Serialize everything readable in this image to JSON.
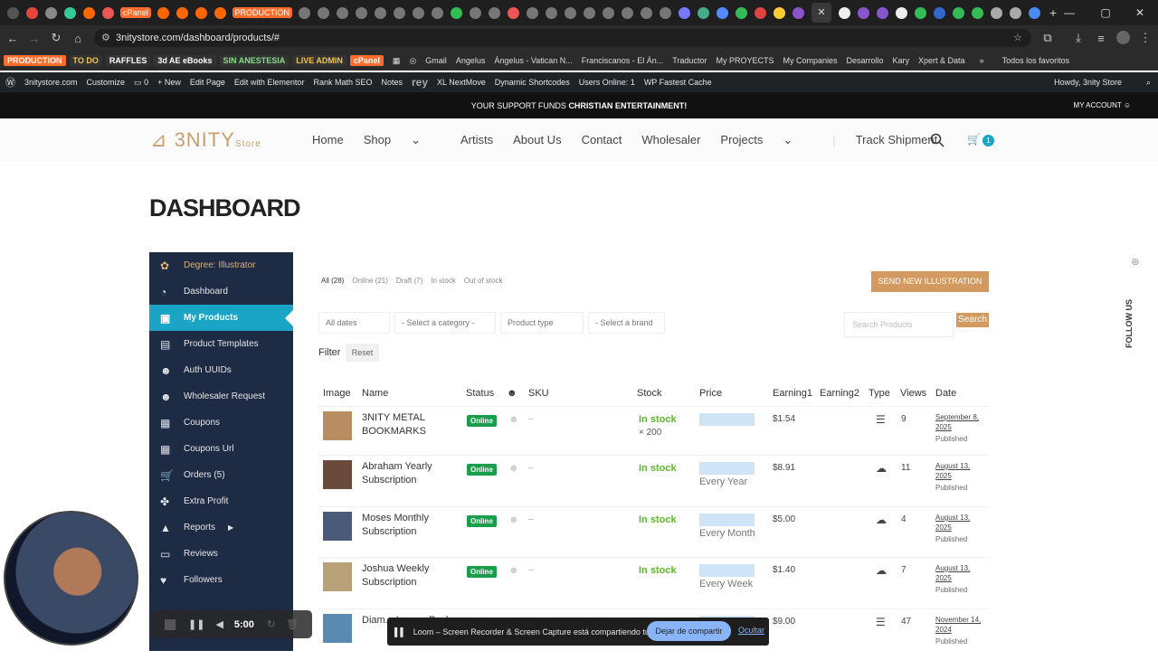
{
  "browser": {
    "tab_pills": [
      "cPanel",
      "PRODUCTION"
    ],
    "url": "3nitystore.com/dashboard/products/#",
    "bookmarks_tags": [
      "PRODUCTION",
      "TO DO",
      "RAFFLES",
      "3d AE eBooks",
      "SIN ANESTESIA",
      "LIVE ADMIN",
      "cPanel"
    ],
    "bookmarks": [
      "Gmail",
      "Angelus",
      "Ángelus - Vatican N...",
      "Franciscanos - El Án...",
      "Traductor",
      "My PROYECTS",
      "My Companies",
      "Desarrollo",
      "Kary",
      "Xpert & Data"
    ],
    "all_bookmarks": "Todos los favoritos"
  },
  "wp_admin_bar": {
    "site": "3nitystore.com",
    "customize": "Customize",
    "comments": "0",
    "new": "New",
    "edit_page": "Edit Page",
    "elementor": "Edit with Elementor",
    "rankmath": "Rank Math SEO",
    "notes": "Notes",
    "rey": "rey",
    "xlnext": "XL NextMove",
    "shortcodes": "Dynamic Shortcodes",
    "users_online": "Users Online: 1",
    "cache": "WP Fastest Cache",
    "howdy": "Howdy, 3nity Store"
  },
  "topnote": {
    "text": "YOUR SUPPORT FUNDS",
    "bold": "CHRISTIAN ENTERTAINMENT!",
    "account": "MY ACCOUNT"
  },
  "header": {
    "logo": "3NITY",
    "logo_sub": "Store",
    "menu": [
      "Home",
      "Shop",
      "Artists",
      "About Us",
      "Contact",
      "Wholesaler",
      "Projects",
      "Track Shipment"
    ],
    "cart_count": "1"
  },
  "page_title": "DASHBOARD",
  "sidebar": {
    "items": [
      {
        "icon": "✿",
        "label": "Degree: Illustrator"
      },
      {
        "icon": "◔",
        "label": "Dashboard"
      },
      {
        "icon": "▣",
        "label": "My Products"
      },
      {
        "icon": "▤",
        "label": "Product Templates"
      },
      {
        "icon": "☻",
        "label": "Auth UUIDs"
      },
      {
        "icon": "☻",
        "label": "Wholesaler Request"
      },
      {
        "icon": "▦",
        "label": "Coupons"
      },
      {
        "icon": "▦",
        "label": "Coupons Url"
      },
      {
        "icon": "🛒",
        "label": "Orders (5)"
      },
      {
        "icon": "✤",
        "label": "Extra Profit"
      },
      {
        "icon": "▲",
        "label": "Reports"
      },
      {
        "icon": "▭",
        "label": "Reviews"
      },
      {
        "icon": "♥",
        "label": "Followers"
      }
    ]
  },
  "filters": [
    "All (28)",
    "Online (21)",
    "Draft (7)",
    "In stock",
    "Out of stock"
  ],
  "send_button": "SEND NEW ILLUSTRATION",
  "selects": {
    "dates": "All dates",
    "category": "- Select a category -",
    "type": "Product type",
    "brand": "- Select a brand"
  },
  "search": {
    "placeholder": "Search Products",
    "button": "Search"
  },
  "filter_label": "Filter",
  "reset": "Reset",
  "table": {
    "headers": [
      "Image",
      "Name",
      "Status",
      "SKU",
      "Stock",
      "Price",
      "Earning1",
      "Earning2",
      "Type",
      "Views",
      "Date"
    ],
    "rows": [
      {
        "name": "3NITY METAL BOOKMARKS",
        "status": "Online",
        "sku": "–",
        "stock": "In stock",
        "qty": "× 200",
        "period": "",
        "earn": "$1.54",
        "type": "☰",
        "views": "9",
        "date": "September 8, 2025",
        "pub": "Published",
        "thumb": "#b98d62"
      },
      {
        "name": "Abraham Yearly Subscription",
        "status": "Online",
        "sku": "–",
        "stock": "In stock",
        "qty": "",
        "period": "Every Year",
        "earn": "$8.91",
        "type": "☁",
        "views": "11",
        "date": "August 13, 2025",
        "pub": "Published",
        "thumb": "#6a4a3a"
      },
      {
        "name": "Moses Monthly Subscription",
        "status": "Online",
        "sku": "–",
        "stock": "In stock",
        "qty": "",
        "period": "Every Month",
        "earn": "$5.00",
        "type": "☁",
        "views": "4",
        "date": "August 13, 2025",
        "pub": "Published",
        "thumb": "#4a5a78"
      },
      {
        "name": "Joshua Weekly Subscription",
        "status": "Online",
        "sku": "–",
        "stock": "In stock",
        "qty": "",
        "period": "Every Week",
        "earn": "$1.40",
        "type": "☁",
        "views": "7",
        "date": "August 13, 2025",
        "pub": "Published",
        "thumb": "#b8a078"
      },
      {
        "name": "Diam... Love... Pack",
        "status": "Online",
        "sku": "",
        "stock": "",
        "qty": "",
        "period": "",
        "earn": "$9.00",
        "type": "☰",
        "views": "47",
        "date": "November 14, 2024",
        "pub": "Published",
        "thumb": "#5a8ab0"
      }
    ]
  },
  "follow_us": "FOLLOW US",
  "loom": {
    "timer": "5:00"
  },
  "share_bar": {
    "text": "Loom – Screen Recorder & Screen Capture está compartiendo tu pantalla.",
    "stop": "Dejar de compartir",
    "hide": "Ocultar"
  }
}
